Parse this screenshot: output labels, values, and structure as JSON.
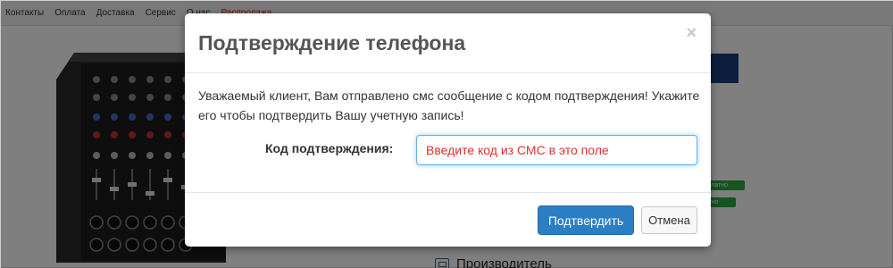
{
  "nav": {
    "items": [
      "Контакты",
      "Оплата",
      "Доставка",
      "Сервис",
      "О нас",
      "Распродажа"
    ]
  },
  "side": {
    "free_badge_1": "есплатно",
    "free_badge_2": "платно",
    "producer_label": "Производитель"
  },
  "modal": {
    "title": "Подтверждение телефона",
    "close_glyph": "×",
    "message": "Уважаемый клиент, Вам отправлено смс сообщение с кодом подтверждения! Укажите его чтобы подтвердить Вашу учетную запись!",
    "code_label": "Код подтверждения:",
    "code_placeholder": "Введите код из СМС в это поле",
    "confirm_label": "Подтвердить",
    "cancel_label": "Отмена"
  },
  "colors": {
    "primary_button": "#2a7fc4",
    "input_focus": "#66afe9",
    "placeholder_red": "#e0302e",
    "sale_red": "#d0201d",
    "free_green": "#2ca940"
  }
}
